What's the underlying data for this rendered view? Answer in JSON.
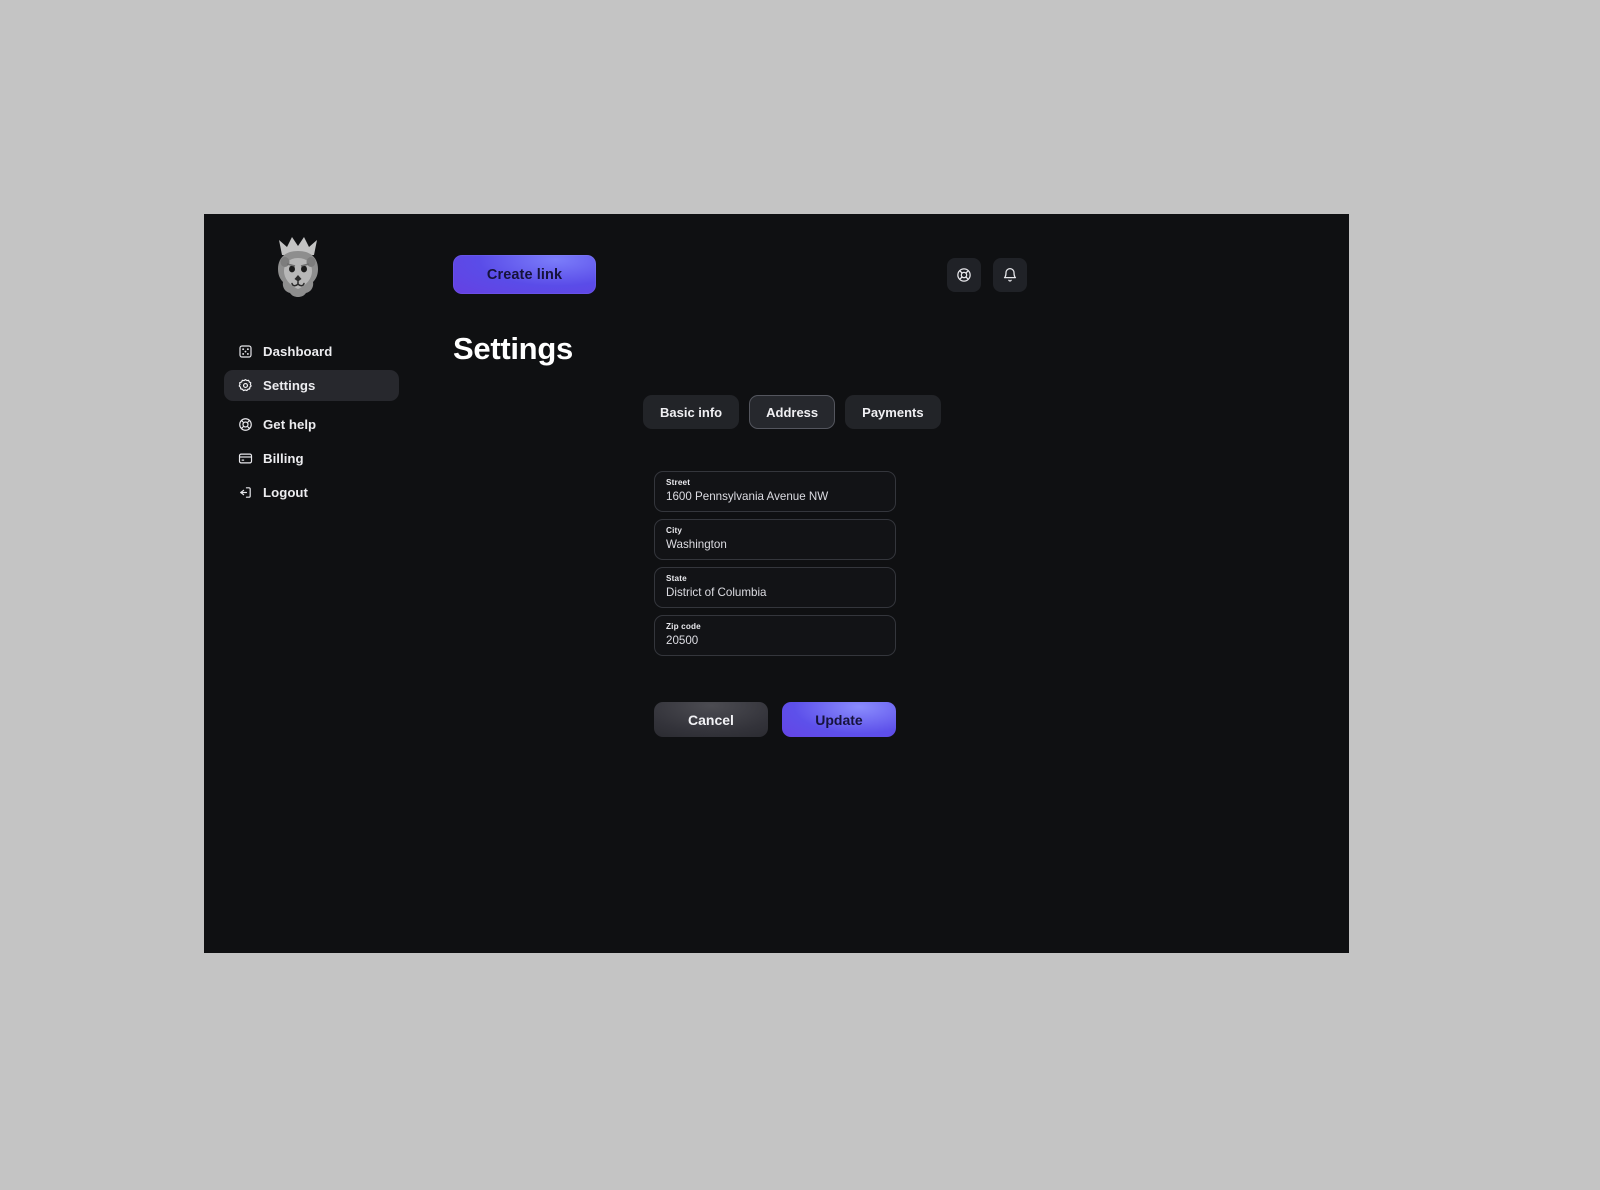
{
  "app": {
    "logo_icon": "crowned-lion-head-logo"
  },
  "header": {
    "create_link_label": "Create link",
    "actions": [
      {
        "icon": "lifebuoy-icon",
        "name": "help-button"
      },
      {
        "icon": "bell-icon",
        "name": "notifications-button"
      }
    ]
  },
  "sidebar": {
    "items": [
      {
        "label": "Dashboard",
        "icon": "layout-grid-icon",
        "active": false
      },
      {
        "label": "Settings",
        "icon": "gear-icon",
        "active": true
      },
      {
        "label": "Get help",
        "icon": "lifebuoy-icon",
        "active": false
      },
      {
        "label": "Billing",
        "icon": "credit-card-icon",
        "active": false
      },
      {
        "label": "Logout",
        "icon": "logout-arrow-icon",
        "active": false
      }
    ]
  },
  "main": {
    "title": "Settings",
    "tabs": [
      {
        "label": "Basic info",
        "active": false
      },
      {
        "label": "Address",
        "active": true
      },
      {
        "label": "Payments",
        "active": false
      }
    ],
    "form": {
      "fields": [
        {
          "label": "Street",
          "value": "1600 Pennsylvania Avenue NW"
        },
        {
          "label": "City",
          "value": "Washington"
        },
        {
          "label": "State",
          "value": "District of Columbia"
        },
        {
          "label": "Zip code",
          "value": "20500"
        }
      ],
      "cancel_label": "Cancel",
      "update_label": "Update"
    }
  },
  "colors": {
    "page_background": "#c4c4c4",
    "app_background": "#0f1012",
    "accent_purple": "#6a3be0",
    "accent_purple_light": "#7b7dfa",
    "surface": "#222428",
    "surface_active": "#27282d",
    "border": "#34363c",
    "text_primary": "#ffffff",
    "text_secondary": "#dcdce2"
  }
}
